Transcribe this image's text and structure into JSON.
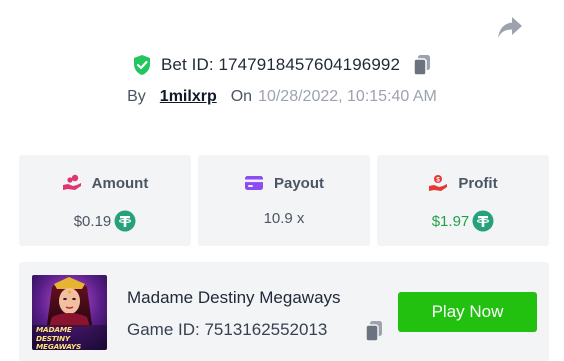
{
  "bet": {
    "id_text": "Bet ID: 1747918457604196992",
    "by_label": "By",
    "username": "1milxrp",
    "on_label": "On",
    "datetime": "10/28/2022, 10:15:40 AM"
  },
  "stats": {
    "amount": {
      "label": "Amount",
      "value": "$0.19",
      "icon": "coins-hand-icon",
      "currency_icon": "tether-icon"
    },
    "payout": {
      "label": "Payout",
      "value": "10.9 x",
      "icon": "credit-card-icon"
    },
    "profit": {
      "label": "Profit",
      "value": "$1.97",
      "icon": "money-hand-icon",
      "currency_icon": "tether-icon"
    }
  },
  "game": {
    "name": "Madame Destiny Megaways",
    "id_text": "Game ID: 7513162552013",
    "thumbnail_text": "MADAME DESTINY MEGAWAYS",
    "play_label": "Play Now"
  },
  "colors": {
    "verified_green": "#22c55e",
    "play_green": "#22c10f",
    "profit_green": "#22a14a",
    "amount_pink": "#e0356f",
    "payout_purple": "#8b4cf6",
    "profit_red": "#e53935",
    "tether_green": "#26a17b",
    "card_bg": "#f3f4f6"
  }
}
